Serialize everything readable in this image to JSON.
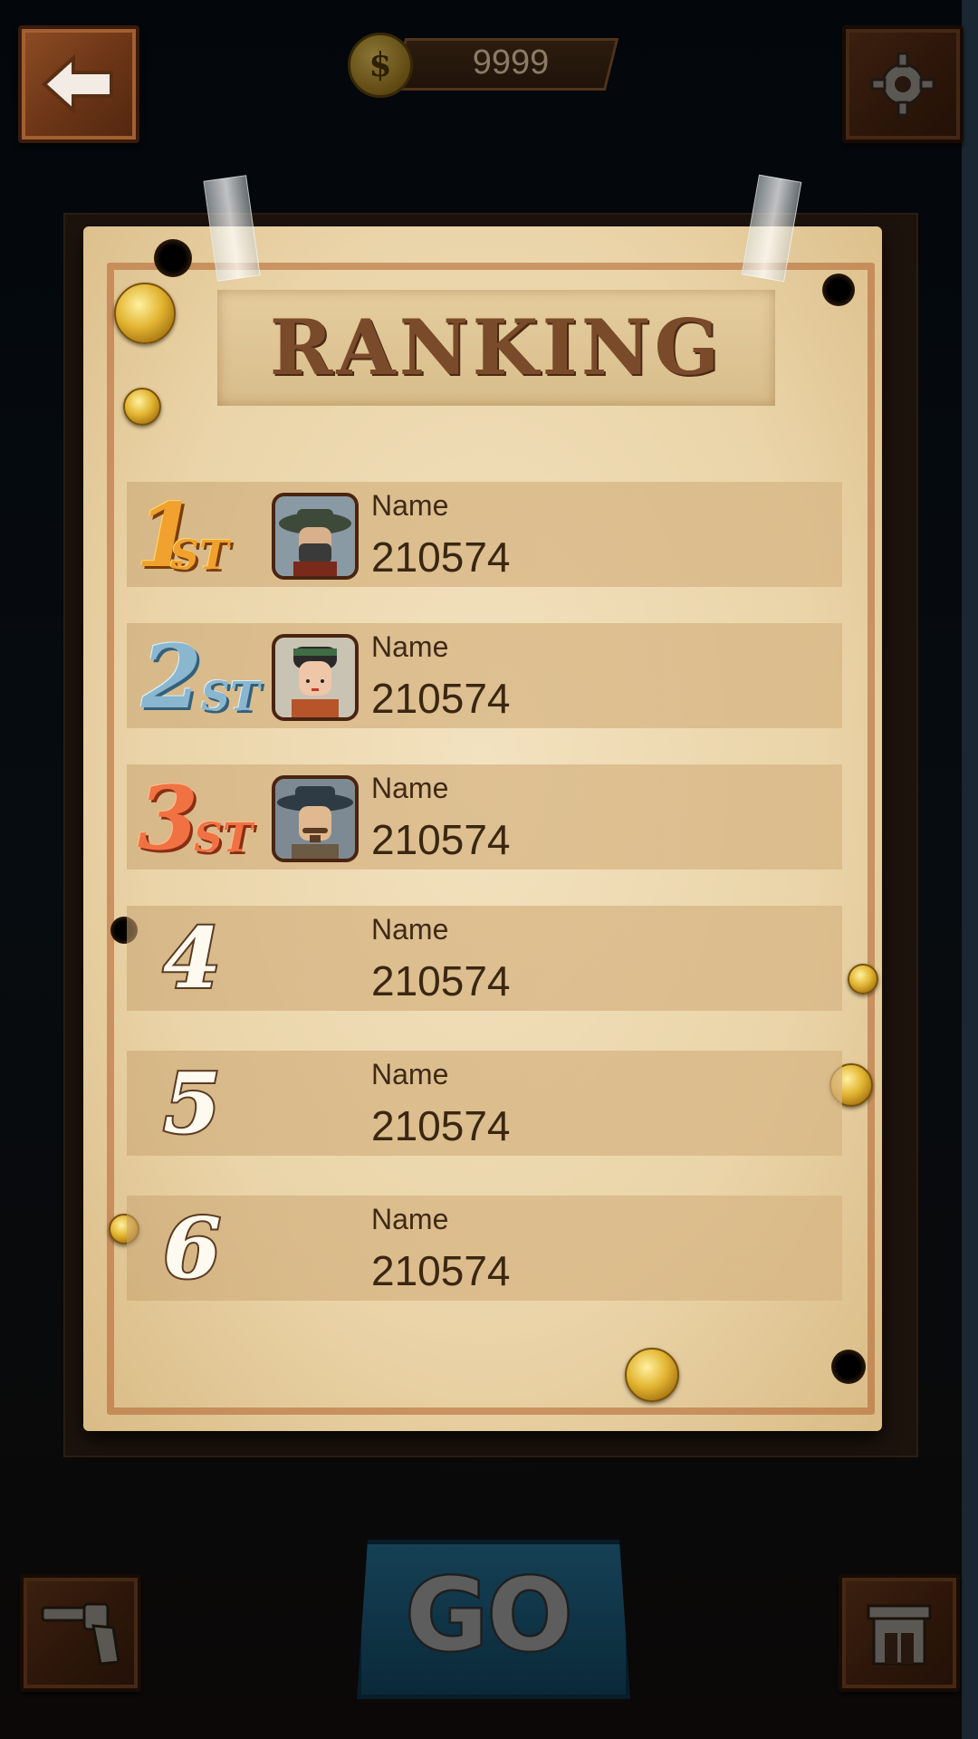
{
  "topbar": {
    "back_icon": "back-arrow-icon",
    "coins": "9999",
    "settings_icon": "gear-icon"
  },
  "ranking": {
    "title": "RANKING",
    "entries": [
      {
        "rank": "1",
        "suffix": "ST",
        "name": "Name",
        "score": "210574",
        "avatar": "bandit-avatar"
      },
      {
        "rank": "2",
        "suffix": "ST",
        "name": "Name",
        "score": "210574",
        "avatar": "cowgirl-avatar"
      },
      {
        "rank": "3",
        "suffix": "ST",
        "name": "Name",
        "score": "210574",
        "avatar": "sheriff-avatar"
      },
      {
        "rank": "4",
        "name": "Name",
        "score": "210574"
      },
      {
        "rank": "5",
        "name": "Name",
        "score": "210574"
      },
      {
        "rank": "6",
        "name": "Name",
        "score": "210574"
      }
    ]
  },
  "bottombar": {
    "weapon_icon": "revolver-icon",
    "go_label": "GO",
    "shop_icon": "saloon-icon"
  },
  "colors": {
    "medal_gold": "#f0a12e",
    "medal_silver": "#8ab7cf",
    "medal_bronze": "#f07243",
    "paper": "#ead4a8"
  }
}
